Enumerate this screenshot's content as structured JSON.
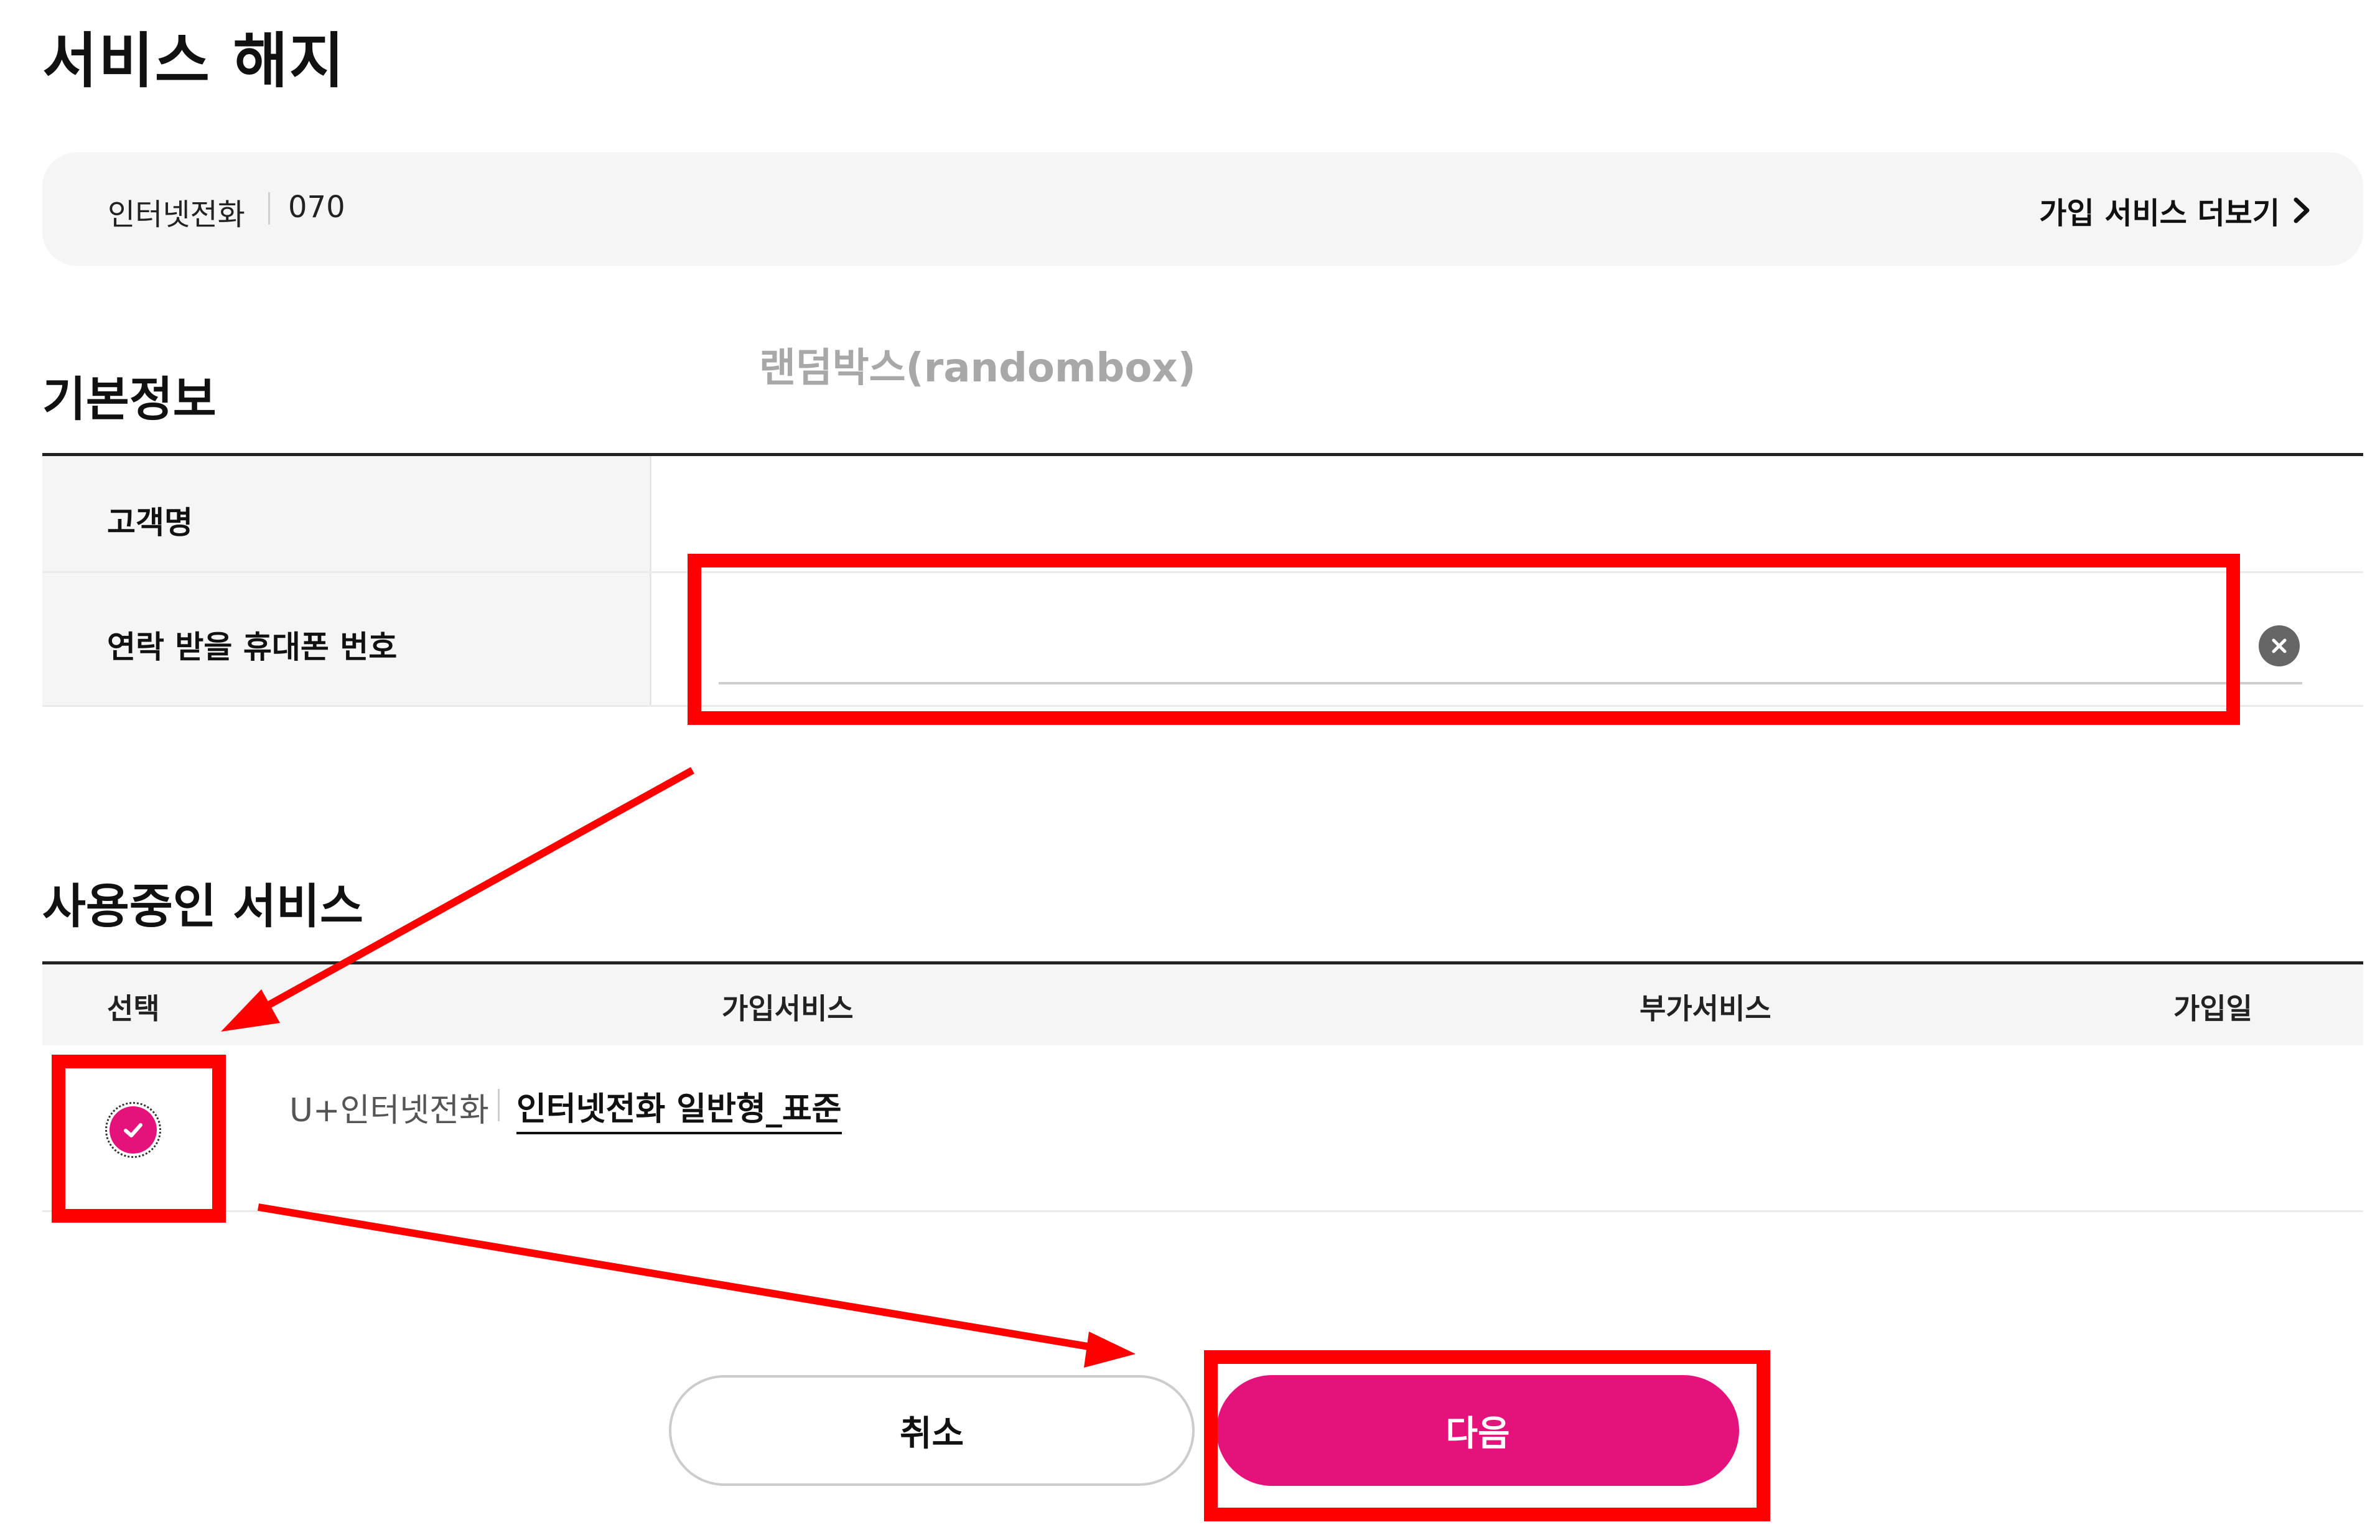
{
  "page": {
    "title": "서비스 해지"
  },
  "service_bar": {
    "service_name": "인터넷전화",
    "service_number": "070",
    "more_link": "가입 서비스 더보기"
  },
  "watermark": "랜덤박스(randombox)",
  "basic_info": {
    "title": "기본정보",
    "fields": [
      {
        "label": "고객명",
        "value": ""
      },
      {
        "label": "연락 받을 휴대폰 번호",
        "value": "",
        "placeholder": ""
      }
    ]
  },
  "services": {
    "title": "사용중인 서비스",
    "columns": [
      "선택",
      "가입서비스",
      "부가서비스",
      "가입일"
    ],
    "rows": [
      {
        "selected": true,
        "service_name": "U+인터넷전화",
        "plan": "인터넷전화 일반형_표준",
        "addon": "",
        "join_date": ""
      }
    ]
  },
  "buttons": {
    "cancel": "취소",
    "next": "다음"
  },
  "colors": {
    "accent": "#e6127c",
    "annotation": "#ff0000",
    "panel_bg": "#f5f5f5"
  },
  "icons": {
    "more_link": "chevron-right-icon",
    "clear": "close-circle-icon",
    "checkbox": "check-icon"
  }
}
